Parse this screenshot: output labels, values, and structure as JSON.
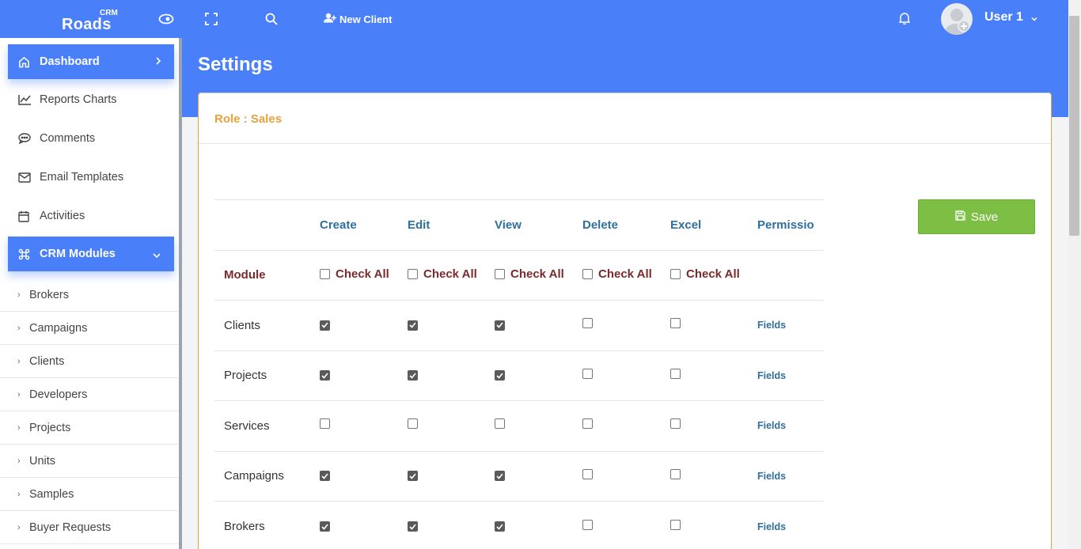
{
  "app": {
    "logo_top": "CRM",
    "logo_main": "Roads",
    "new_client_label": "New Client",
    "user_name": "User 1"
  },
  "icons": {
    "eye": "eye-icon",
    "fullscreen": "fullscreen-icon",
    "search": "search-icon",
    "user_plus": "user-plus-icon",
    "bell": "bell-icon",
    "avatar": "user-avatar-icon",
    "caret": "chevron-down-icon"
  },
  "colors": {
    "primary": "#4a7ffa",
    "role_accent": "#e7a33b",
    "column_header": "#2f6f9e",
    "module_header": "#7a2b2b",
    "save_button": "#7dbf45"
  },
  "sidebar": {
    "main_items": [
      {
        "label": "Dashboard",
        "icon": "home-icon"
      },
      {
        "label": "Reports Charts",
        "icon": "line-chart-icon"
      },
      {
        "label": "Comments",
        "icon": "comment-icon"
      },
      {
        "label": "Email Templates",
        "icon": "envelope-icon"
      },
      {
        "label": "Activities",
        "icon": "calendar-icon"
      },
      {
        "label": "CRM Modules",
        "icon": "command-icon"
      }
    ],
    "sub_items": [
      {
        "label": "Brokers"
      },
      {
        "label": "Campaigns"
      },
      {
        "label": "Clients"
      },
      {
        "label": "Developers"
      },
      {
        "label": "Projects"
      },
      {
        "label": "Units"
      },
      {
        "label": "Samples"
      },
      {
        "label": "Buyer Requests"
      }
    ]
  },
  "page": {
    "title": "Settings",
    "role_label": "Role : Sales",
    "save_label": "Save"
  },
  "table": {
    "columns": [
      "Create",
      "Edit",
      "View",
      "Delete",
      "Excel",
      "Permissio"
    ],
    "module_header": "Module",
    "check_all_label": "Check All",
    "fields_label": "Fields",
    "rows": [
      {
        "module": "Clients",
        "create": true,
        "edit": true,
        "view": true,
        "delete": false,
        "excel": false
      },
      {
        "module": "Projects",
        "create": true,
        "edit": true,
        "view": true,
        "delete": false,
        "excel": false
      },
      {
        "module": "Services",
        "create": false,
        "edit": false,
        "view": false,
        "delete": false,
        "excel": false
      },
      {
        "module": "Campaigns",
        "create": true,
        "edit": true,
        "view": true,
        "delete": false,
        "excel": false
      },
      {
        "module": "Brokers",
        "create": true,
        "edit": true,
        "view": true,
        "delete": false,
        "excel": false
      }
    ]
  }
}
